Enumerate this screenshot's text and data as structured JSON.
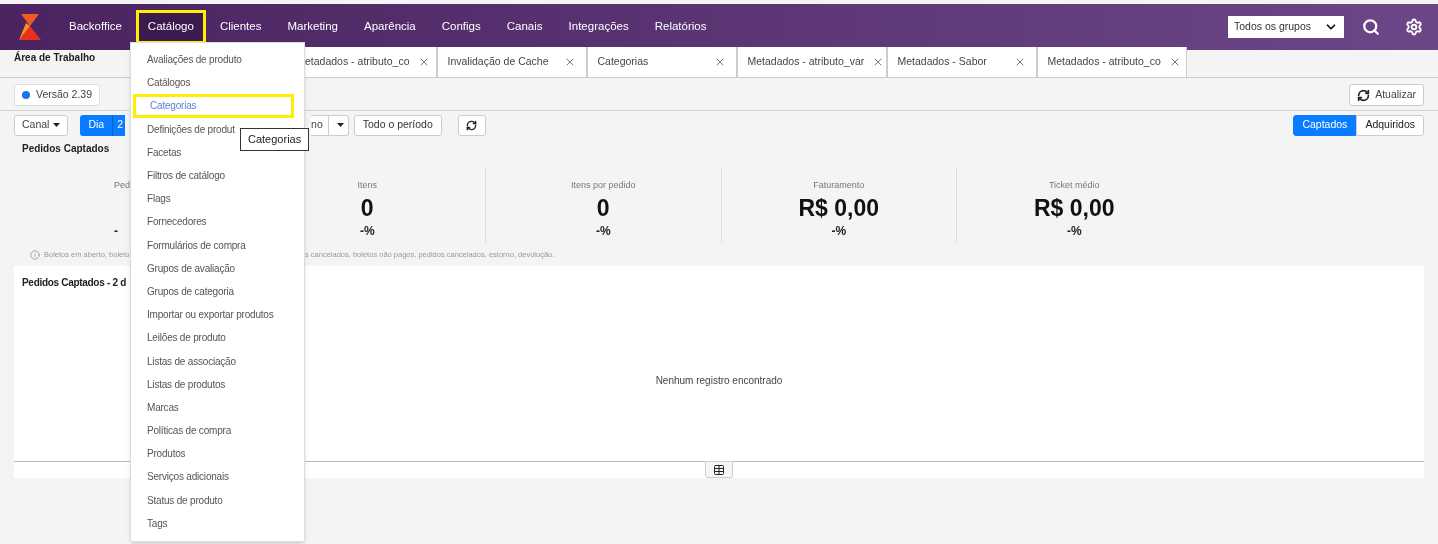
{
  "nav": {
    "items": [
      {
        "label": "Backoffice",
        "highlighted": false
      },
      {
        "label": "Catálogo",
        "highlighted": true
      },
      {
        "label": "Clientes",
        "highlighted": false
      },
      {
        "label": "Marketing",
        "highlighted": false
      },
      {
        "label": "Aparência",
        "highlighted": false
      },
      {
        "label": "Configs",
        "highlighted": false
      },
      {
        "label": "Canais",
        "highlighted": false
      },
      {
        "label": "Integrações",
        "highlighted": false
      },
      {
        "label": "Relatórios",
        "highlighted": false
      }
    ],
    "group_select": {
      "value": "Todos os grupos"
    }
  },
  "workspace": {
    "title": "Área de Trabalho",
    "tabs": [
      {
        "label": "etadados - atributo_co"
      },
      {
        "label": "Invalidação de Cache"
      },
      {
        "label": "Categorias"
      },
      {
        "label": "Metadados - atributo_var"
      },
      {
        "label": "Metadados - Sabor"
      },
      {
        "label": "Metadados - atributo_co"
      }
    ]
  },
  "version": "Versão 2.39",
  "refresh_button": "Atualizar",
  "filters": {
    "channel": "Canal",
    "period": [
      {
        "label": "Dia",
        "selected": true
      },
      {
        "label": "2",
        "selected": true
      }
    ],
    "range_partial": "no",
    "all_period": "Todo o período"
  },
  "mode": [
    {
      "label": "Captados",
      "selected": true
    },
    {
      "label": "Adquiridos",
      "selected": false
    }
  ],
  "section_title": "Pedidos Captados",
  "stats": [
    {
      "label": "Ped",
      "percent": "-"
    },
    {
      "label": "Itens",
      "value": "0",
      "percent": "-%"
    },
    {
      "label": "Itens por pedido",
      "value": "0",
      "percent": "-%"
    },
    {
      "label": "Faturamento",
      "value": "R$ 0,00",
      "percent": "-%"
    },
    {
      "label": "Ticket médio",
      "value": "R$ 0,00",
      "percent": "-%"
    }
  ],
  "notice": [
    "Boletos em aberto, boleto",
    "s cancelados, boletos não pagos, pedidos cancelados, estorno, devolução."
  ],
  "orders_panel": {
    "title": "Pedidos Captados - 2 d",
    "empty": "Nenhum registro encontrado"
  },
  "catalog_menu": {
    "items": [
      {
        "label": "Avaliações de produto",
        "selected": false,
        "highlighted": false
      },
      {
        "label": "Catálogos",
        "selected": false,
        "highlighted": false
      },
      {
        "label": "Categorias",
        "selected": true,
        "highlighted": true
      },
      {
        "label": "Definições de produt",
        "selected": false,
        "highlighted": false
      },
      {
        "label": "Facetas",
        "selected": false,
        "highlighted": false
      },
      {
        "label": "Filtros de catálogo",
        "selected": false,
        "highlighted": false
      },
      {
        "label": "Flags",
        "selected": false,
        "highlighted": false
      },
      {
        "label": "Fornecedores",
        "selected": false,
        "highlighted": false
      },
      {
        "label": "Formulários de compra",
        "selected": false,
        "highlighted": false
      },
      {
        "label": "Grupos de avaliação",
        "selected": false,
        "highlighted": false
      },
      {
        "label": "Grupos de categoria",
        "selected": false,
        "highlighted": false
      },
      {
        "label": "Importar ou exportar produtos",
        "selected": false,
        "highlighted": false
      },
      {
        "label": "Leilões de produto",
        "selected": false,
        "highlighted": false
      },
      {
        "label": "Listas de associação",
        "selected": false,
        "highlighted": false
      },
      {
        "label": "Listas de produtos",
        "selected": false,
        "highlighted": false
      },
      {
        "label": "Marcas",
        "selected": false,
        "highlighted": false
      },
      {
        "label": "Políticas de compra",
        "selected": false,
        "highlighted": false
      },
      {
        "label": "Produtos",
        "selected": false,
        "highlighted": false
      },
      {
        "label": "Serviços adicionais",
        "selected": false,
        "highlighted": false
      },
      {
        "label": "Status de produto",
        "selected": false,
        "highlighted": false
      },
      {
        "label": "Tags",
        "selected": false,
        "highlighted": false
      }
    ]
  },
  "tooltip": "Categorias"
}
